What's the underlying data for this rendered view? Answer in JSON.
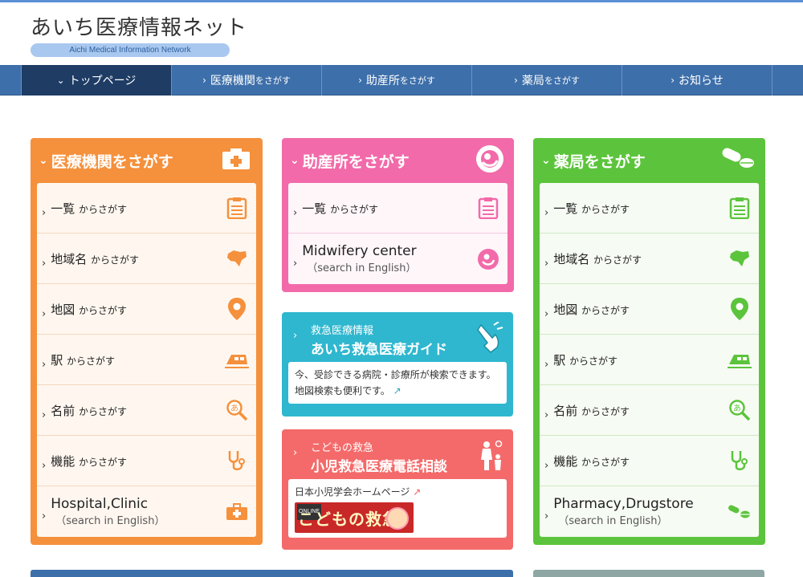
{
  "logo": {
    "title": "あいち医療情報ネット",
    "subtitle": "Aichi Medical Information Network"
  },
  "nav": {
    "items": [
      {
        "label": "トップページ",
        "suffix": ""
      },
      {
        "label": "医療機関",
        "suffix": "をさがす"
      },
      {
        "label": "助産所",
        "suffix": "をさがす"
      },
      {
        "label": "薬局",
        "suffix": "をさがす"
      },
      {
        "label": "お知らせ",
        "suffix": ""
      }
    ]
  },
  "hospital": {
    "title": "医療機関をさがす",
    "rows": [
      {
        "main": "一覧",
        "sub": "からさがす"
      },
      {
        "main": "地域名",
        "sub": "からさがす"
      },
      {
        "main": "地図",
        "sub": "からさがす"
      },
      {
        "main": "駅",
        "sub": "からさがす"
      },
      {
        "main": "名前",
        "sub": "からさがす"
      },
      {
        "main": "機能",
        "sub": "からさがす"
      },
      {
        "en": "Hospital,Clinic",
        "en_sub": "（search in English）"
      }
    ]
  },
  "midwifery": {
    "title": "助産所をさがす",
    "rows": [
      {
        "main": "一覧",
        "sub": "からさがす"
      },
      {
        "en": "Midwifery center",
        "en_sub": "（search in English）"
      }
    ]
  },
  "pharmacy": {
    "title": "薬局をさがす",
    "rows": [
      {
        "main": "一覧",
        "sub": "からさがす"
      },
      {
        "main": "地域名",
        "sub": "からさがす"
      },
      {
        "main": "地図",
        "sub": "からさがす"
      },
      {
        "main": "駅",
        "sub": "からさがす"
      },
      {
        "main": "名前",
        "sub": "からさがす"
      },
      {
        "main": "機能",
        "sub": "からさがす"
      },
      {
        "en": "Pharmacy,Drugstore",
        "en_sub": "（search in English）"
      }
    ]
  },
  "emergency": {
    "pre": "救急医療情報",
    "title": "あいち救急医療ガイド",
    "body": "今、受診できる病院・診療所が検索できます。地図検索も便利です。"
  },
  "child": {
    "pre": "こどもの救急",
    "title": "小児救急医療電話相談",
    "link": "日本小児学会ホームページ",
    "banner_tag": "ONLINE",
    "banner_text": "こどもの救急"
  },
  "colors": {
    "orange": "#f5903c",
    "pink": "#f26aa9",
    "green": "#5cc43c",
    "cyan": "#2fb7cf",
    "red": "#f46a6a",
    "navy": "#3d6faa"
  }
}
